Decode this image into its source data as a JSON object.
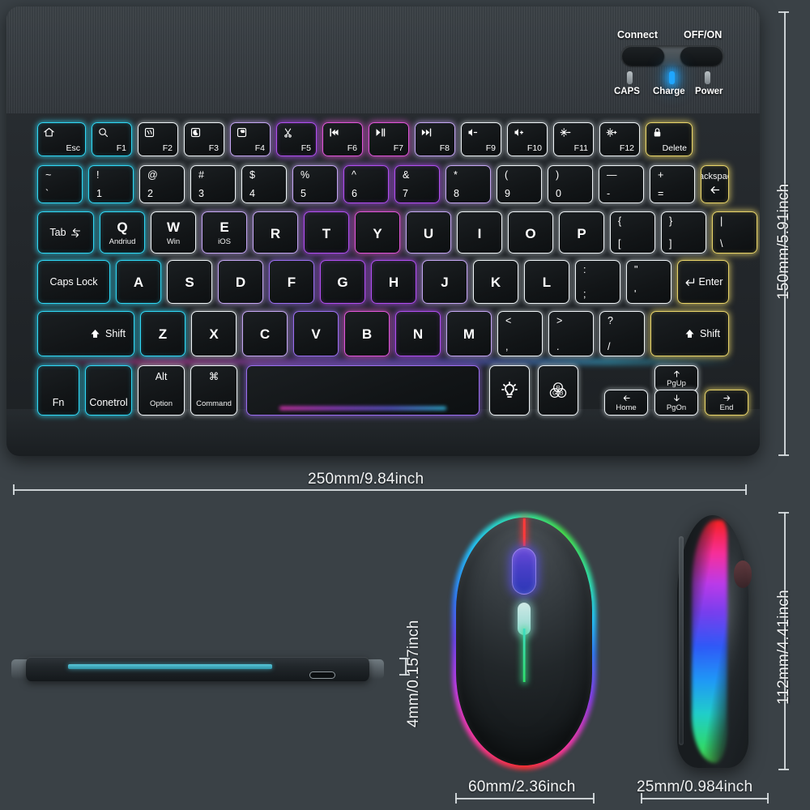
{
  "product": {
    "keyboard_top_view": "wireless-rgb-keyboard-top-view",
    "keyboard_side_view": "wireless-rgb-keyboard-side-profile",
    "mouse_top_view": "wireless-rgb-mouse-top-view",
    "mouse_side_view": "wireless-rgb-mouse-side-view"
  },
  "dimensions": {
    "keyboard_height": "150mm/5.91inch",
    "keyboard_width": "250mm/9.84inch",
    "keyboard_thickness": "4mm/0.157inch",
    "mouse_width": "60mm/2.36inch",
    "mouse_height": "112mm/4.41inch",
    "mouse_thickness": "25mm/0.984inch"
  },
  "control_panel": {
    "connect_label": "Connect",
    "power_switch_label": "OFF/ON",
    "indicators": [
      {
        "label": "CAPS",
        "state": "off"
      },
      {
        "label": "Charge",
        "state": "on",
        "color": "#1fa6ff"
      },
      {
        "label": "Power",
        "state": "off"
      }
    ]
  },
  "keyboard": {
    "function_row": [
      {
        "name": "esc",
        "icon": "home-icon",
        "label": "Esc",
        "glow": "g-cyan"
      },
      {
        "name": "f1",
        "icon": "search-icon",
        "label": "F1",
        "glow": "g-cyan"
      },
      {
        "name": "f2",
        "icon": "app-switcher-icon",
        "label": "F2",
        "glow": "g-white"
      },
      {
        "name": "f3",
        "icon": "moon-icon",
        "label": "F3",
        "glow": "g-white"
      },
      {
        "name": "f4",
        "icon": "keyboard-backlight-icon",
        "label": "F4",
        "glow": "g-lilac"
      },
      {
        "name": "f5",
        "icon": "scissors-icon",
        "label": "F5",
        "glow": "g-purple"
      },
      {
        "name": "f6",
        "icon": "previous-track-icon",
        "label": "F6",
        "glow": "g-magenta"
      },
      {
        "name": "f7",
        "icon": "play-pause-icon",
        "label": "F7",
        "glow": "g-magenta"
      },
      {
        "name": "f8",
        "icon": "next-track-icon",
        "label": "F8",
        "glow": "g-lilac"
      },
      {
        "name": "f9",
        "icon": "volume-down-icon",
        "label": "F9",
        "glow": "g-white"
      },
      {
        "name": "f10",
        "icon": "volume-up-icon",
        "label": "F10",
        "glow": "g-white"
      },
      {
        "name": "f11",
        "icon": "brightness-down-icon",
        "label": "F11",
        "glow": "g-white"
      },
      {
        "name": "f12",
        "icon": "brightness-up-icon",
        "label": "F12",
        "glow": "g-white"
      },
      {
        "name": "delete",
        "icon": "lock-icon",
        "label": "Delete",
        "glow": "g-yellow"
      }
    ],
    "number_row": [
      {
        "name": "tilde",
        "top": "~",
        "bottom": "`",
        "glow": "g-cyan"
      },
      {
        "name": "1",
        "top": "!",
        "bottom": "1",
        "glow": "g-cyan"
      },
      {
        "name": "2",
        "top": "@",
        "bottom": "2",
        "glow": "g-white"
      },
      {
        "name": "3",
        "top": "#",
        "bottom": "3",
        "glow": "g-white"
      },
      {
        "name": "4",
        "top": "$",
        "bottom": "4",
        "glow": "g-white"
      },
      {
        "name": "5",
        "top": "%",
        "bottom": "5",
        "glow": "g-lilac"
      },
      {
        "name": "6",
        "top": "^",
        "bottom": "6",
        "glow": "g-purple"
      },
      {
        "name": "7",
        "top": "&",
        "bottom": "7",
        "glow": "g-purple"
      },
      {
        "name": "8",
        "top": "*",
        "bottom": "8",
        "glow": "g-lilac"
      },
      {
        "name": "9",
        "top": "(",
        "bottom": "9",
        "glow": "g-white"
      },
      {
        "name": "0",
        "top": ")",
        "bottom": "0",
        "glow": "g-white"
      },
      {
        "name": "minus",
        "top": "—",
        "bottom": "-",
        "glow": "g-white"
      },
      {
        "name": "equals",
        "top": "+",
        "bottom": "=",
        "glow": "g-white"
      }
    ],
    "backspace": {
      "label": "Backspace",
      "icon": "left-arrow-icon",
      "glow": "g-yellow"
    },
    "tab": {
      "label": "Tab",
      "icon": "tab-arrows-icon",
      "glow": "g-cyan"
    },
    "qwerty_row": [
      {
        "name": "q",
        "label": "Q",
        "sub": "Andriud",
        "glow": "g-cyan"
      },
      {
        "name": "w",
        "label": "W",
        "sub": "Win",
        "glow": "g-white"
      },
      {
        "name": "e",
        "label": "E",
        "sub": "iOS",
        "glow": "g-lilac"
      },
      {
        "name": "r",
        "label": "R",
        "sub": "",
        "glow": "g-lilac"
      },
      {
        "name": "t",
        "label": "T",
        "sub": "",
        "glow": "g-purple"
      },
      {
        "name": "y",
        "label": "Y",
        "sub": "",
        "glow": "g-magenta"
      },
      {
        "name": "u",
        "label": "U",
        "sub": "",
        "glow": "g-lilac"
      },
      {
        "name": "i",
        "label": "I",
        "sub": "",
        "glow": "g-white"
      },
      {
        "name": "o",
        "label": "O",
        "sub": "",
        "glow": "g-white"
      },
      {
        "name": "p",
        "label": "P",
        "sub": "",
        "glow": "g-white"
      }
    ],
    "qwerty_brackets": [
      {
        "name": "left-bracket",
        "top": "{",
        "bottom": "[",
        "glow": "g-white"
      },
      {
        "name": "right-bracket",
        "top": "}",
        "bottom": "]",
        "glow": "g-white"
      },
      {
        "name": "backslash",
        "top": "|",
        "bottom": "\\",
        "glow": "g-yellow"
      }
    ],
    "caps_lock": {
      "label": "Caps Lock",
      "glow": "g-cyan"
    },
    "home_row": [
      {
        "name": "a",
        "label": "A",
        "glow": "g-cyan"
      },
      {
        "name": "s",
        "label": "S",
        "glow": "g-white"
      },
      {
        "name": "d",
        "label": "D",
        "glow": "g-lilac"
      },
      {
        "name": "f",
        "label": "F",
        "glow": "g-violet"
      },
      {
        "name": "g",
        "label": "G",
        "glow": "g-purple"
      },
      {
        "name": "h",
        "label": "H",
        "glow": "g-purple"
      },
      {
        "name": "j",
        "label": "J",
        "glow": "g-lilac"
      },
      {
        "name": "k",
        "label": "K",
        "glow": "g-white"
      },
      {
        "name": "l",
        "label": "L",
        "glow": "g-white"
      }
    ],
    "home_row_punct": [
      {
        "name": "semicolon",
        "top": ":",
        "bottom": ";",
        "glow": "g-white"
      },
      {
        "name": "quote",
        "top": "\"",
        "bottom": "'",
        "glow": "g-white"
      }
    ],
    "enter": {
      "label": "Enter",
      "icon": "enter-arrow-icon",
      "glow": "g-yellow"
    },
    "shift_left": {
      "label": "Shift",
      "icon": "shift-up-arrow-icon",
      "glow": "g-cyan"
    },
    "bottom_alpha_row": [
      {
        "name": "z",
        "label": "Z",
        "glow": "g-cyan"
      },
      {
        "name": "x",
        "label": "X",
        "glow": "g-white"
      },
      {
        "name": "c",
        "label": "C",
        "glow": "g-lilac"
      },
      {
        "name": "v",
        "label": "V",
        "glow": "g-violet"
      },
      {
        "name": "b",
        "label": "B",
        "glow": "g-magenta"
      },
      {
        "name": "n",
        "label": "N",
        "glow": "g-purple"
      },
      {
        "name": "m",
        "label": "M",
        "glow": "g-lilac"
      }
    ],
    "bottom_punct": [
      {
        "name": "comma",
        "top": "<",
        "bottom": ",",
        "glow": "g-white"
      },
      {
        "name": "period",
        "top": ">",
        "bottom": ".",
        "glow": "g-white"
      },
      {
        "name": "slash",
        "top": "?",
        "bottom": "/",
        "glow": "g-white"
      }
    ],
    "shift_right": {
      "label": "Shift",
      "icon": "shift-up-arrow-icon",
      "glow": "g-yellow"
    },
    "modifier_row": [
      {
        "name": "fn",
        "label": "Fn",
        "sub": "",
        "glow": "g-cyan"
      },
      {
        "name": "control",
        "label": "Conetrol",
        "sub": "",
        "glow": "g-cyan"
      },
      {
        "name": "alt-option",
        "label": "Alt",
        "sub": "Option",
        "glow": "g-white"
      },
      {
        "name": "command",
        "label": "⌘",
        "sub": "Command",
        "glow": "g-white"
      }
    ],
    "spacebar": {
      "name": "spacebar",
      "glow": "g-violet"
    },
    "backlight_key": {
      "name": "backlight",
      "icon": "lightbulb-icon",
      "glow": "g-white"
    },
    "rgb_key": {
      "name": "rgb",
      "icon": "rgb-circles-icon",
      "glow": "g-white"
    },
    "nav_keys": [
      {
        "name": "home",
        "label": "Home",
        "icon": "arrow-left-icon",
        "glow": "g-white"
      },
      {
        "name": "pgup",
        "label": "PgUp",
        "icon": "arrow-up-icon",
        "glow": "g-white"
      },
      {
        "name": "pgdn",
        "label": "PgOn",
        "icon": "arrow-down-icon",
        "glow": "g-white"
      },
      {
        "name": "end",
        "label": "End",
        "icon": "arrow-right-icon",
        "glow": "g-yellow"
      }
    ]
  },
  "colors": {
    "background": "#3a4146",
    "keyboard_body": "#23272b",
    "dimension_line": "#d7dcdf",
    "charge_led": "#1fa6ff",
    "glow_cyan": "#2fd8f5",
    "glow_purple": "#b04ef0",
    "glow_magenta": "#e055d8",
    "glow_yellow": "#e8d469"
  }
}
